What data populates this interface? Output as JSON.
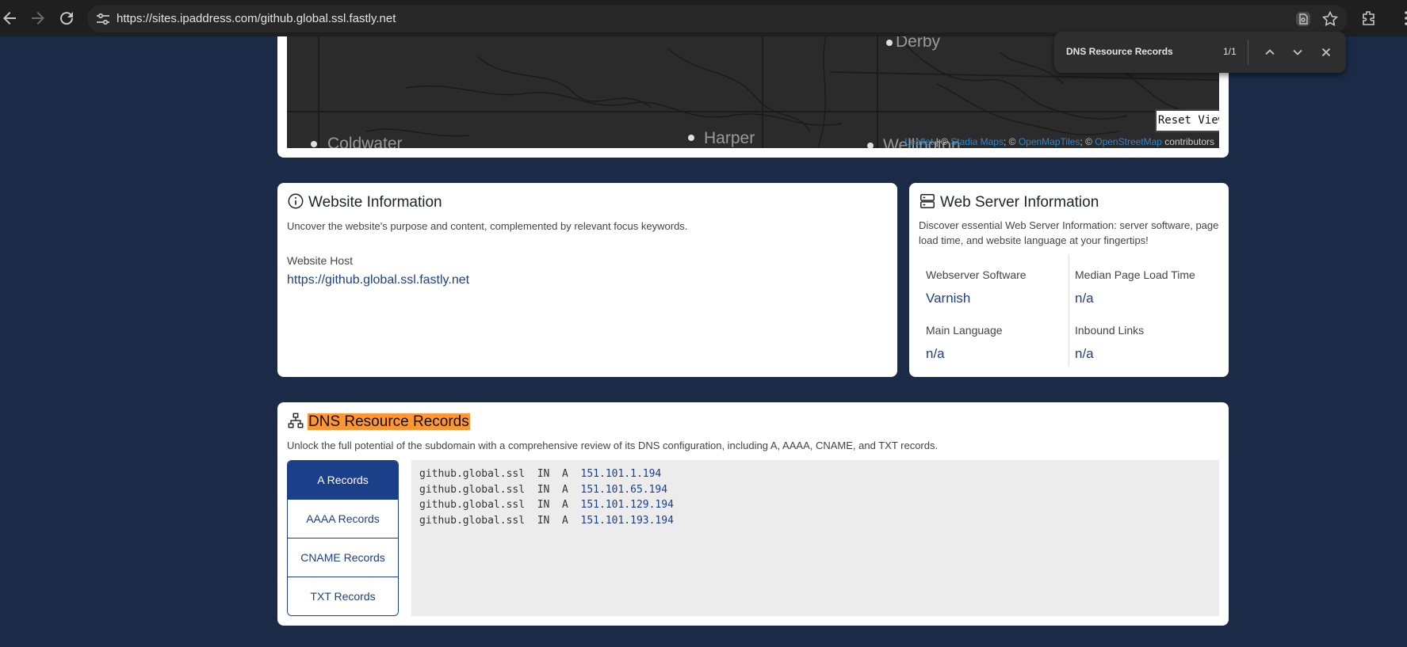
{
  "browser": {
    "url": "https://sites.ipaddress.com/github.global.ssl.fastly.net"
  },
  "find_bar": {
    "query": "DNS Resource Records",
    "count": "1/1"
  },
  "map": {
    "labels": [
      "Derby",
      "Coldwater",
      "Harper",
      "Wellington"
    ],
    "reset_label": "Reset View",
    "attribution": {
      "leaflet": "Leaflet",
      "sep1": " | © ",
      "stadia": "Stadia Maps",
      "sep2": "; © ",
      "openmaptiles": "OpenMapTiles",
      "sep3": "; © ",
      "osm": "OpenStreetMap",
      "contributors": " contributors"
    }
  },
  "website_info": {
    "title": "Website Information",
    "description": "Uncover the website's purpose and content, complemented by relevant focus keywords.",
    "host_label": "Website Host",
    "host_value": "https://github.global.ssl.fastly.net"
  },
  "server_info": {
    "title": "Web Server Information",
    "description_line1": "Discover essential Web Server Information: server software, page",
    "description_line2": "load time, and website language at your fingertips!",
    "fields": [
      {
        "label": "Webserver Software",
        "value": "Varnish"
      },
      {
        "label": "Median Page Load Time",
        "value": "n/a"
      },
      {
        "label": "Main Language",
        "value": "n/a"
      },
      {
        "label": "Inbound Links",
        "value": "n/a"
      }
    ]
  },
  "dns": {
    "title": "DNS Resource Records",
    "description": "Unlock the full potential of the subdomain with a comprehensive review of its DNS configuration, including A, AAAA, CNAME, and TXT records.",
    "tabs": [
      "A Records",
      "AAAA Records",
      "CNAME Records",
      "TXT Records"
    ],
    "active_tab": "A Records",
    "records": [
      {
        "name": "github.global.ssl",
        "class": "IN",
        "type": "A",
        "ip": "151.101.1.194"
      },
      {
        "name": "github.global.ssl",
        "class": "IN",
        "type": "A",
        "ip": "151.101.65.194"
      },
      {
        "name": "github.global.ssl",
        "class": "IN",
        "type": "A",
        "ip": "151.101.129.194"
      },
      {
        "name": "github.global.ssl",
        "class": "IN",
        "type": "A",
        "ip": "151.101.193.194"
      }
    ]
  },
  "colors": {
    "page_bg": "#1b2a47",
    "accent": "#1c3f8a",
    "find_highlight": "#ff9632"
  }
}
